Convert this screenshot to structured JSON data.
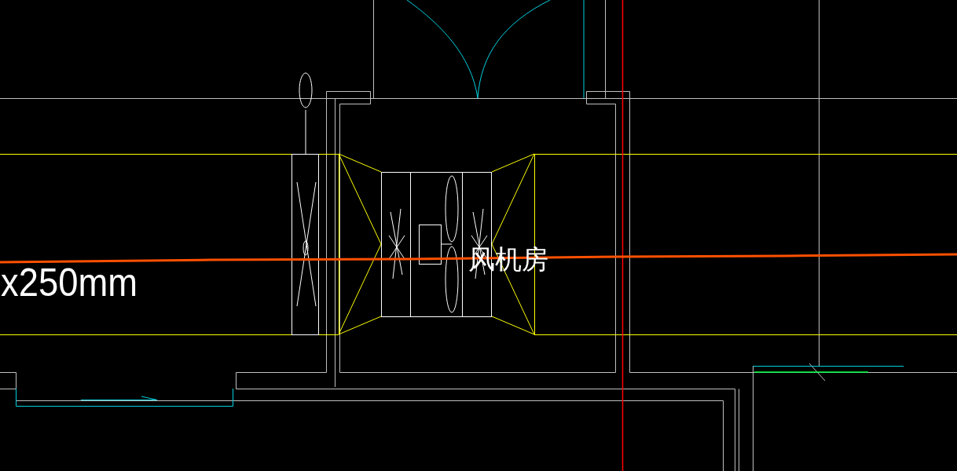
{
  "drawing": {
    "labels": [
      {
        "text": "x250mm"
      },
      {
        "text": "风机房"
      }
    ]
  }
}
